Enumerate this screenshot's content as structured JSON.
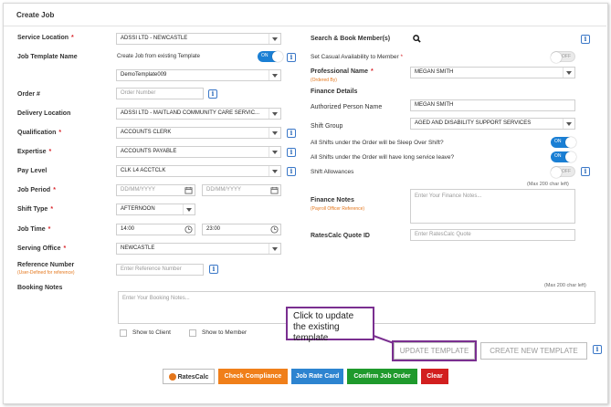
{
  "page": {
    "title": "Create Job"
  },
  "left": {
    "service_location": {
      "label": "Service Location",
      "value": "ADSSI LTD - NEWCASTLE"
    },
    "job_template": {
      "label": "Job Template Name",
      "toggle_text": "Create Job from existing Template",
      "toggle_state": "ON",
      "value": "DemoTemplate009"
    },
    "order_no": {
      "label": "Order #",
      "placeholder": "Order Number"
    },
    "delivery_location": {
      "label": "Delivery Location",
      "value": "ADSSI LTD - MAITLAND COMMUNITY CARE SERVIC..."
    },
    "qualification": {
      "label": "Qualification",
      "value": "ACCOUNTS CLERK"
    },
    "expertise": {
      "label": "Expertise",
      "value": "ACCOUNTS PAYABLE"
    },
    "pay_level": {
      "label": "Pay Level",
      "value": "CLK L4 ACCTCLK"
    },
    "job_period": {
      "label": "Job Period",
      "start_placeholder": "DD/MM/YYYY",
      "end_placeholder": "DD/MM/YYYY"
    },
    "shift_type": {
      "label": "Shift Type",
      "value": "AFTERNOON"
    },
    "job_time": {
      "label": "Job Time",
      "start": "14:00",
      "end": "23:00"
    },
    "serving_office": {
      "label": "Serving Office",
      "value": "NEWCASTLE"
    },
    "reference_number": {
      "label": "Reference Number",
      "sub": "(User-Defined for reference)",
      "placeholder": "Enter Reference Number"
    }
  },
  "right": {
    "search": {
      "label": "Search & Book Member(s)"
    },
    "casual": {
      "label": "Set Casual Availability to Member",
      "toggle_state": "OFF"
    },
    "professional": {
      "label": "Professional Name",
      "sub": "(Ordered By)",
      "value": "MEGAN SMITH"
    },
    "finance_details": {
      "label": "Finance Details"
    },
    "authorized": {
      "label": "Authorized Person Name",
      "value": "MEGAN SMITH"
    },
    "shift_group": {
      "label": "Shift Group",
      "value": "AGED AND DISABILITY SUPPORT SERVICES"
    },
    "sleep_over": {
      "label": "All Shifts under the Order will be Sleep Over Shift?",
      "toggle_state": "ON"
    },
    "long_service": {
      "label": "All Shifts under the Order will have long service leave?",
      "toggle_state": "ON"
    },
    "allowances": {
      "label": "Shift Allowances",
      "toggle_state": "OFF"
    },
    "finance_notes": {
      "max_hint": "(Max 200 char left)",
      "label": "Finance Notes",
      "sub": "(Payroll Officer Reference)",
      "placeholder": "Enter Your Finance Notes..."
    },
    "ratescalc": {
      "label": "RatesCalc Quote ID",
      "placeholder": "Enter RatesCalc Quote"
    }
  },
  "booking": {
    "label": "Booking Notes",
    "max_hint": "(Max 200 char left)",
    "placeholder": "Enter Your Booking Notes...",
    "show_client": "Show to Client",
    "show_member": "Show to Member"
  },
  "callout": {
    "text": "Click to update the existing template"
  },
  "template_buttons": {
    "update": "UPDATE TEMPLATE",
    "create": "CREATE NEW TEMPLATE"
  },
  "actions": {
    "ratescalc": "RatesCalc",
    "check_compliance": "Check Compliance",
    "job_rate_card": "Job Rate Card",
    "confirm": "Confirm Job Order",
    "clear": "Clear"
  },
  "colors": {
    "orange": "#f07f1a",
    "blue": "#2d84d0",
    "green": "#1f9a2c",
    "red": "#d21f1f",
    "toggle_on": "#1a7fd4",
    "callout_border": "#7a2f90"
  },
  "icons": [
    "info-icon",
    "search-icon",
    "calendar-icon",
    "clock-icon",
    "chevron-down-icon"
  ]
}
